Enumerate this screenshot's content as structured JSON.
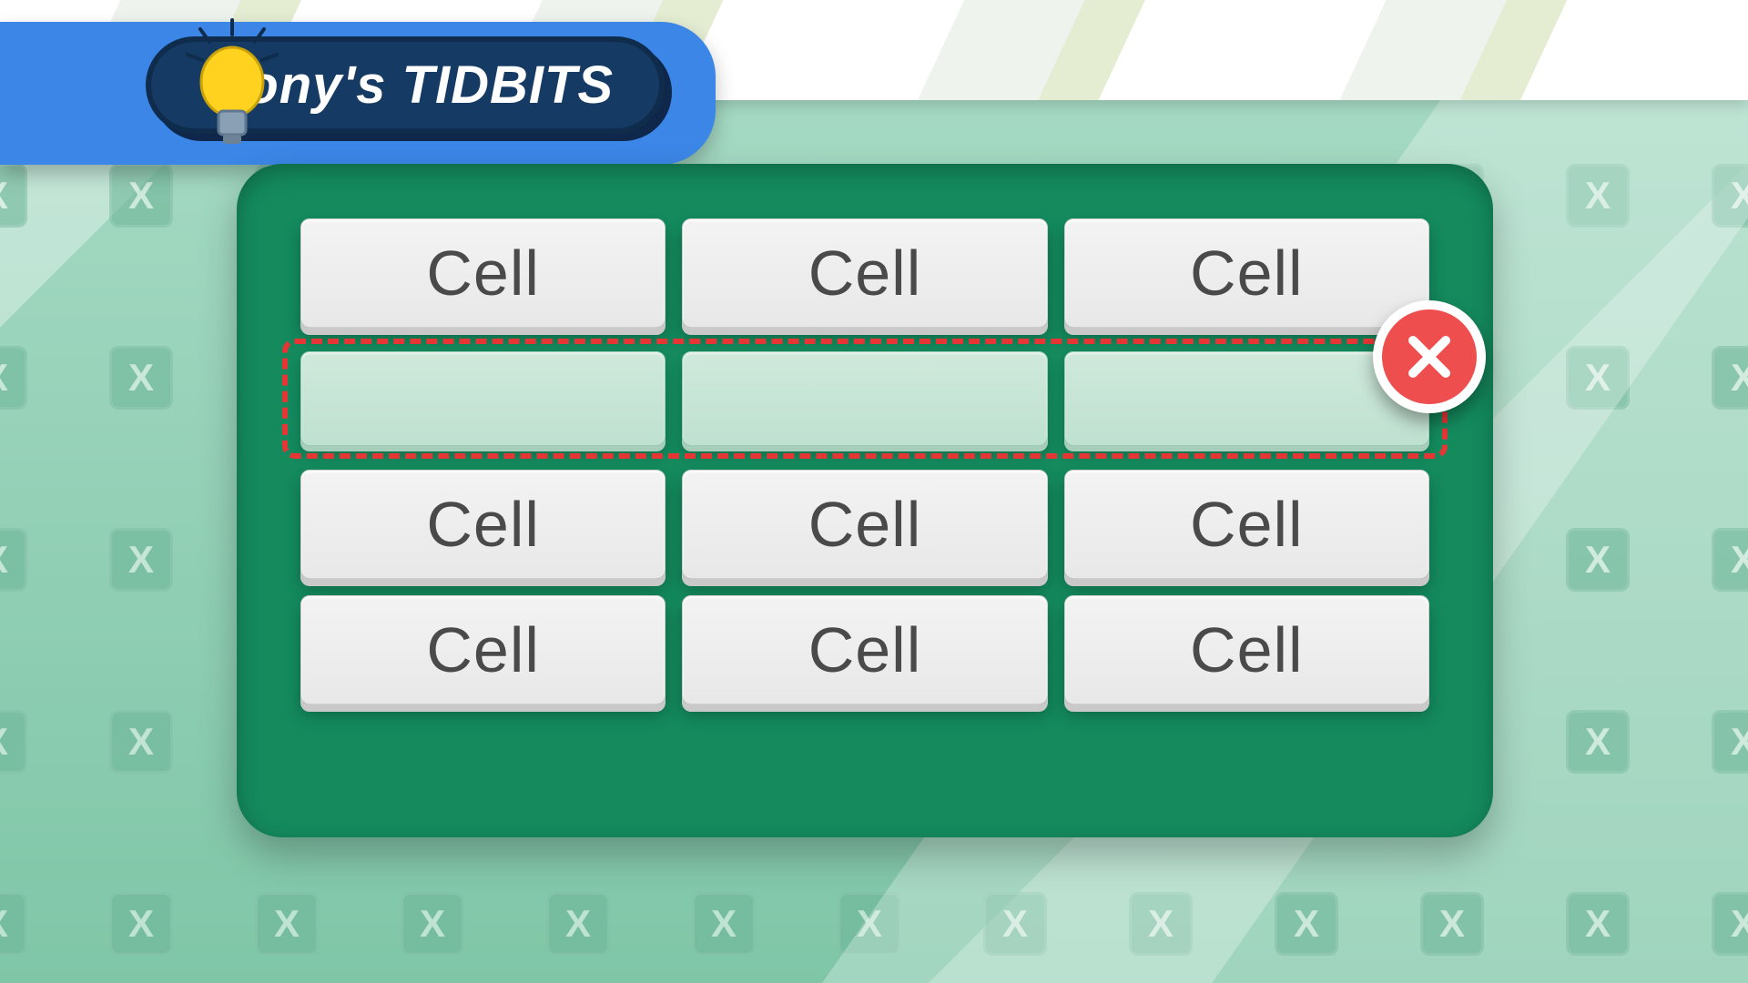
{
  "banner": {
    "title": "Tony's TIDBITS"
  },
  "panel": {
    "rows": [
      {
        "cells": [
          "Cell",
          "Cell",
          "Cell"
        ],
        "selected": false
      },
      {
        "cells": [
          "",
          "",
          ""
        ],
        "selected": true
      },
      {
        "cells": [
          "Cell",
          "Cell",
          "Cell"
        ],
        "selected": false
      },
      {
        "cells": [
          "Cell",
          "Cell",
          "Cell"
        ],
        "selected": false
      }
    ]
  },
  "icons": {
    "bulb": "lightbulb-icon",
    "close": "close-icon"
  },
  "colors": {
    "panel": "#148a5d",
    "banner": "#3b86e6",
    "bannerInner": "#153a63",
    "selection": "#e63535",
    "closeBadge": "#ef4e4e"
  }
}
